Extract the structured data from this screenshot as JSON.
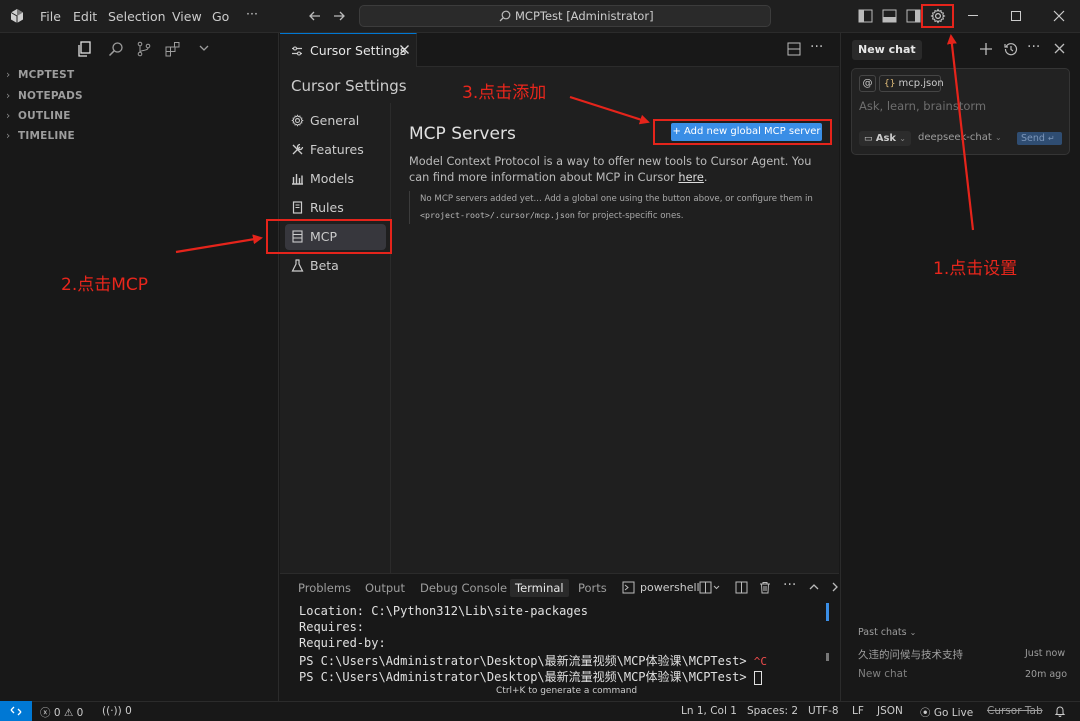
{
  "app": {
    "window_title": "MCPTest [Administrator]",
    "menu": [
      "File",
      "Edit",
      "Selection",
      "View",
      "Go"
    ],
    "menu_more": "···"
  },
  "explorer": {
    "sections": [
      "MCPTEST",
      "NOTEPADS",
      "OUTLINE",
      "TIMELINE"
    ]
  },
  "editor": {
    "tab_label": "Cursor Settings",
    "settings_title": "Cursor Settings",
    "nav_items": [
      {
        "label": "General",
        "icon": "gear-icon"
      },
      {
        "label": "Features",
        "icon": "tools-icon"
      },
      {
        "label": "Models",
        "icon": "bar-chart-icon"
      },
      {
        "label": "Rules",
        "icon": "document-icon"
      },
      {
        "label": "MCP",
        "icon": "server-icon"
      },
      {
        "label": "Beta",
        "icon": "flask-icon"
      }
    ],
    "active_nav": "MCP",
    "mcp": {
      "heading": "MCP Servers",
      "add_button": "+ Add new global MCP server",
      "desc_text": "Model Context Protocol is a way to offer new tools to Cursor Agent. You can find more information about MCP in Cursor",
      "desc_link": "here",
      "desc_end": ".",
      "note_text": "No MCP servers added yet... Add a global one using the button above, or configure them in",
      "note_code": "<project-root>/.cursor/mcp.json",
      "note_end": "for project-specific ones."
    }
  },
  "panel": {
    "tabs": [
      "Problems",
      "Output",
      "Debug Console",
      "Terminal",
      "Ports"
    ],
    "active_tab": "Terminal",
    "shell": "powershell",
    "lines": [
      "Location: C:\\Python312\\Lib\\site-packages",
      "Requires:",
      "Required-by:",
      "PS C:\\Users\\Administrator\\Desktop\\最新流量视频\\MCP体验课\\MCPTest> ",
      "PS C:\\Users\\Administrator\\Desktop\\最新流量视频\\MCP体验课\\MCPTest> "
    ],
    "interrupt": "^C",
    "hint": "Ctrl+K to generate a command"
  },
  "chat": {
    "tab_label": "New chat",
    "at_symbol": "@",
    "file_chip": "mcp.json",
    "placeholder": "Ask, learn, brainstorm",
    "mode": "Ask",
    "model": "deepseek-chat",
    "send": "Send",
    "past_chats_label": "Past chats",
    "past_chats": [
      {
        "title": "久违的问候与技术支持",
        "time": "Just now"
      },
      {
        "title": "New chat",
        "time": "20m ago"
      }
    ]
  },
  "statusbar": {
    "errors": "0",
    "warnings": "0",
    "ports": "0",
    "position": "Ln 1, Col 1",
    "spaces": "Spaces: 2",
    "encoding": "UTF-8",
    "eol": "LF",
    "language": "JSON",
    "live": "Go Live",
    "cursor_tab": "Cursor Tab"
  },
  "annotations": {
    "step1": "1.点击设置",
    "step2": "2.点击MCP",
    "step3": "3.点击添加"
  },
  "colors": {
    "accent": "#0078d4",
    "button": "#3a8ee6",
    "annotation": "#e5241b"
  }
}
